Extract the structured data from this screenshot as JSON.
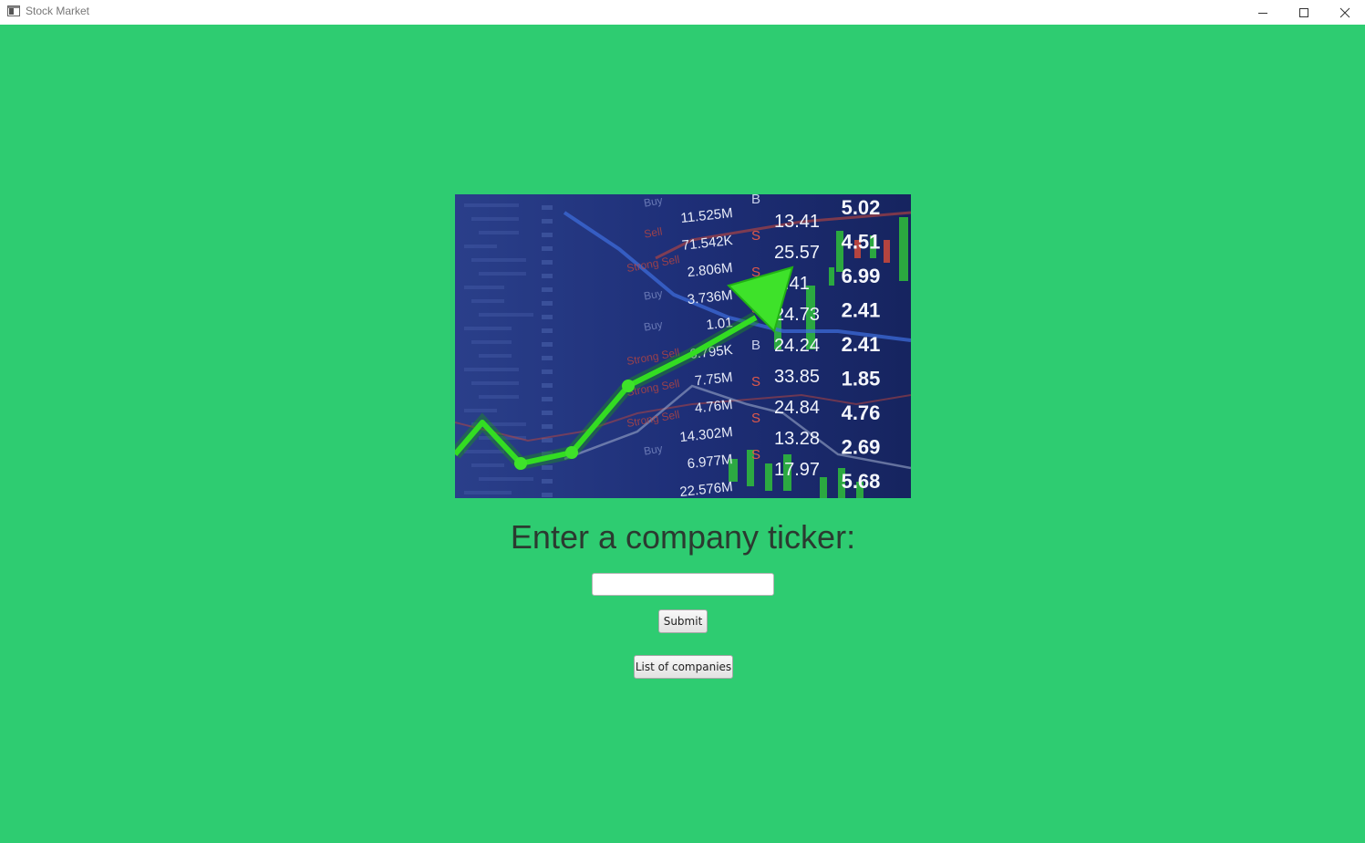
{
  "window": {
    "title": "Stock Market",
    "controls": [
      "minimize-icon",
      "maximize-icon",
      "close-icon"
    ]
  },
  "hero_image": {
    "alt_icon": "stock-chart-image",
    "prices": [
      "5.02",
      "4.51",
      "6.99",
      "2.41",
      "2.41",
      "1.85",
      "4.76",
      "2.69",
      "5.68"
    ],
    "mid_prices": [
      "13.41",
      "25.57",
      ".41",
      "24.73",
      "24.24",
      "33.85",
      "24.84",
      "13.28",
      "17.97"
    ],
    "volumes": [
      "11.525M",
      "71.542K",
      "2.806M",
      "3.736M",
      "1.01",
      "6.795K",
      "7.75M",
      "4.76M",
      "14.302M",
      "6.977M",
      "22.576M"
    ],
    "signals": [
      "B",
      "S",
      "S",
      "S",
      "B",
      "S",
      "S",
      "S"
    ],
    "actions": [
      "Buy",
      "Sell",
      "Strong Sell",
      "Buy",
      "Buy",
      "Strong Sell",
      "Strong Sell",
      "Strong Sell",
      "Buy"
    ]
  },
  "form": {
    "prompt": "Enter a company ticker:",
    "ticker_value": "",
    "ticker_placeholder": "",
    "submit_label": "Submit",
    "list_label": "List of companies"
  },
  "colors": {
    "background": "#2ecc71",
    "image_base": "#1b2a6b",
    "arrow": "#33dd22"
  }
}
